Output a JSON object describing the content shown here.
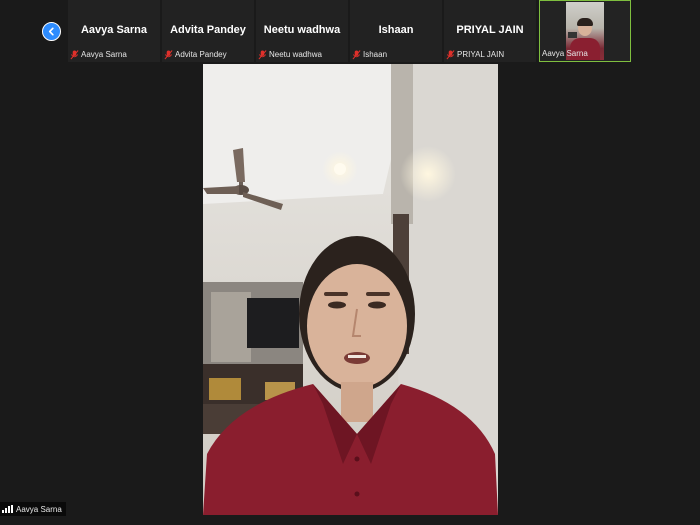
{
  "gallery": {
    "participants": [
      {
        "display_name": "Aavya Sarna",
        "tag_name": "Aavya Sarna",
        "muted": true
      },
      {
        "display_name": "Advita Pandey",
        "tag_name": "Advita Pandey",
        "muted": true
      },
      {
        "display_name": "Neetu wadhwa",
        "tag_name": "Neetu wadhwa",
        "muted": true
      },
      {
        "display_name": "Ishaan",
        "tag_name": "Ishaan",
        "muted": true
      },
      {
        "display_name": "PRIYAL JAIN",
        "tag_name": "PRIYAL JAIN",
        "muted": true
      }
    ],
    "active_video_tag": "Aavya Sarna"
  },
  "main": {
    "speaker_label": "Aavya Sarna"
  },
  "icons": {
    "nav": "chevron-left-icon",
    "mute": "mic-muted-icon",
    "signal": "signal-icon"
  },
  "colors": {
    "accent": "#2d8cff",
    "active_border": "#7fbf3f",
    "muted_mic": "#e0302b",
    "background": "#1a1a1a"
  }
}
